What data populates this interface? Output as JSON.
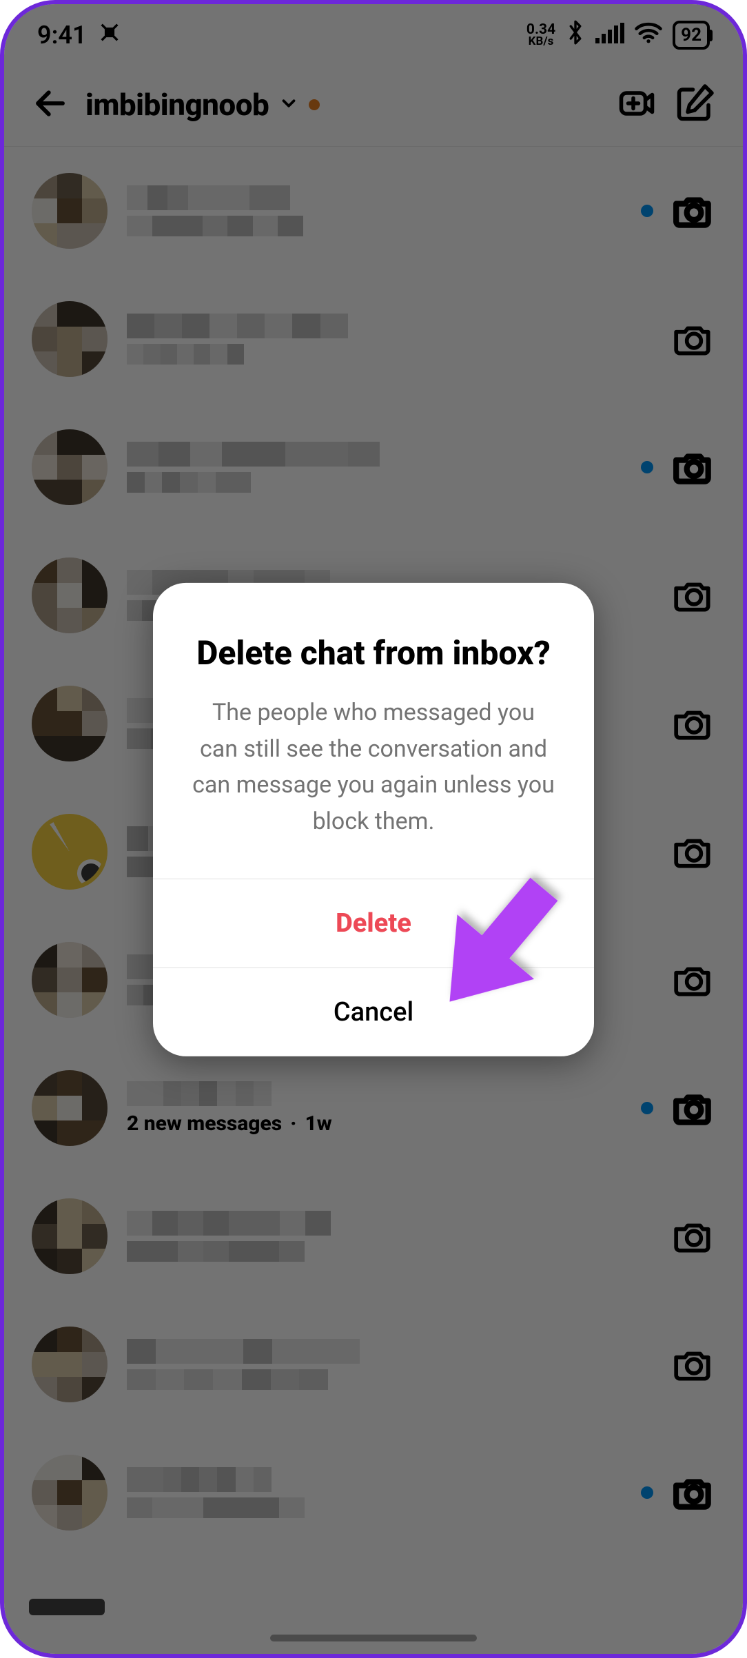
{
  "status": {
    "time": "9:41",
    "kbps_value": "0.34",
    "kbps_unit": "KB/s",
    "battery_pct": "92"
  },
  "header": {
    "username": "imbibingnoob"
  },
  "dialog": {
    "title": "Delete chat from inbox?",
    "message": "The people who messaged you can still see the conversation and can message you again unless you block them.",
    "delete_label": "Delete",
    "cancel_label": "Cancel"
  },
  "chats": {
    "visible_subtitle_bold": "2 new messages",
    "visible_subtitle_age": "1w"
  },
  "rows": [
    {
      "unread": true,
      "camera_bold": true
    },
    {
      "unread": false,
      "camera_bold": false
    },
    {
      "unread": true,
      "camera_bold": true
    },
    {
      "unread": false,
      "camera_bold": false
    },
    {
      "unread": false,
      "camera_bold": false
    },
    {
      "unread": false,
      "camera_bold": false,
      "hand_avatar": true
    },
    {
      "unread": false,
      "camera_bold": false
    },
    {
      "unread": true,
      "camera_bold": true,
      "show_subtitle": true
    },
    {
      "unread": false,
      "camera_bold": false
    },
    {
      "unread": false,
      "camera_bold": false
    },
    {
      "unread": true,
      "camera_bold": true
    }
  ],
  "colors": {
    "accent_purple": "#8a3ffc",
    "danger_red": "#ed4956",
    "unread_blue": "#0095f6"
  }
}
